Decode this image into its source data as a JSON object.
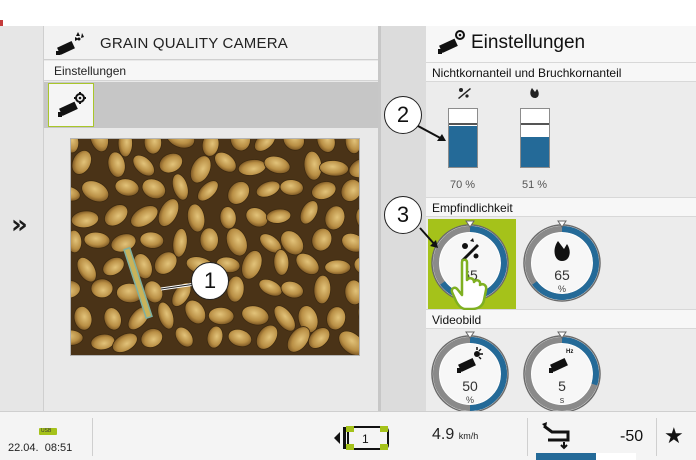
{
  "left_panel": {
    "title": "GRAIN QUALITY CAMERA",
    "subtitle": "Einstellungen"
  },
  "right_panel": {
    "title": "Einstellungen",
    "section_ratio": {
      "label": "Nichtkornanteil und Bruchkornanteil",
      "bars": [
        {
          "icon": "chaff-icon",
          "fill_fraction": 0.7,
          "label": "70 %"
        },
        {
          "icon": "broken-kernel-icon",
          "fill_fraction": 0.51,
          "label": "51 %"
        }
      ]
    },
    "section_sensitivity": {
      "label": "Empfindlichkeit",
      "dials": [
        {
          "icon": "chaff-icon",
          "value": "65",
          "unit": "%",
          "level": 0.65,
          "selected": true
        },
        {
          "icon": "broken-kernel-icon",
          "value": "65",
          "unit": "%",
          "level": 0.65,
          "selected": false
        }
      ]
    },
    "section_video": {
      "label": "Videobild",
      "dials": [
        {
          "icon": "camera-brightness-icon",
          "value": "50",
          "unit": "%",
          "level": 0.5
        },
        {
          "icon": "camera-frequency-icon",
          "value": "5",
          "unit": "s",
          "level": 0.3
        }
      ]
    }
  },
  "callouts": [
    "1",
    "2",
    "3"
  ],
  "bottom_bar": {
    "usb_label": "USB",
    "date": "22.04.",
    "time": "08:51",
    "gear": "1",
    "speed_value": "4.9",
    "speed_unit": "km/h",
    "lift_value": "-50",
    "lift_level": 0.6
  },
  "colors": {
    "accent_green": "#a5c21a",
    "fill_blue": "#246a98"
  }
}
